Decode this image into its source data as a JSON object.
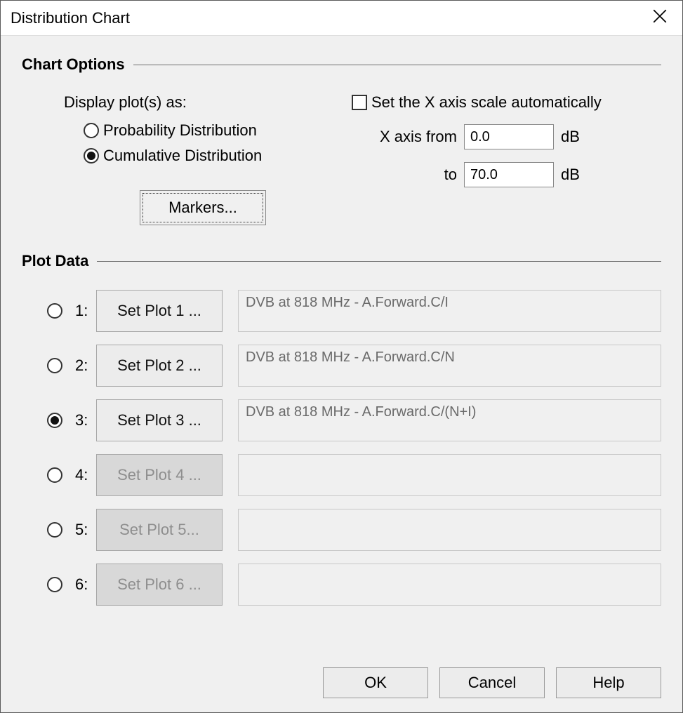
{
  "window": {
    "title": "Distribution Chart"
  },
  "chartOptions": {
    "heading": "Chart Options",
    "displayPlotsLabel": "Display plot(s) as:",
    "probabilityLabel": "Probability Distribution",
    "cumulativeLabel": "Cumulative Distribution",
    "selectedDistribution": "cumulative",
    "autoScaleLabel": "Set the X axis scale automatically",
    "autoScaleChecked": false,
    "xFromLabel": "X axis from",
    "xToLabel": "to",
    "xFromValue": "0.0",
    "xToValue": "70.0",
    "xUnit": "dB",
    "markersLabel": "Markers..."
  },
  "plotData": {
    "heading": "Plot Data",
    "selectedIndex": 3,
    "rows": [
      {
        "idx": "1:",
        "button": "Set Plot 1 ...",
        "desc": "DVB at 818 MHz - A.Forward.C/I",
        "enabled": true
      },
      {
        "idx": "2:",
        "button": "Set Plot 2 ...",
        "desc": "DVB at 818 MHz - A.Forward.C/N",
        "enabled": true
      },
      {
        "idx": "3:",
        "button": "Set Plot 3 ...",
        "desc": "DVB at 818 MHz - A.Forward.C/(N+I)",
        "enabled": true
      },
      {
        "idx": "4:",
        "button": "Set Plot 4 ...",
        "desc": "",
        "enabled": false
      },
      {
        "idx": "5:",
        "button": "Set Plot 5...",
        "desc": "",
        "enabled": false
      },
      {
        "idx": "6:",
        "button": "Set Plot 6 ...",
        "desc": "",
        "enabled": false
      }
    ]
  },
  "footer": {
    "ok": "OK",
    "cancel": "Cancel",
    "help": "Help"
  }
}
